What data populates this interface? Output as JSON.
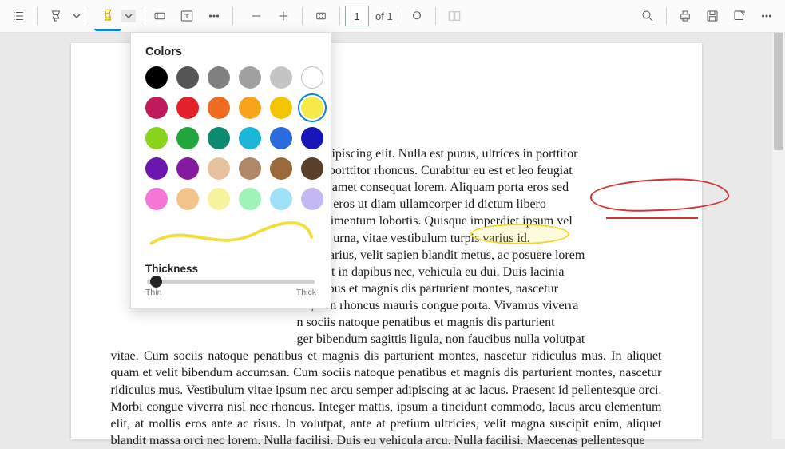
{
  "toolbar": {
    "page_current": "1",
    "page_total_label": "of 1"
  },
  "popover": {
    "title": "Colors",
    "thickness_label": "Thickness",
    "thin_label": "Thin",
    "thick_label": "Thick",
    "preview_color": "#f0df3a",
    "selected_index": 11,
    "colors": [
      "#000000",
      "#555555",
      "#808080",
      "#a0a0a0",
      "#c4c4c4",
      "#ffffff",
      "#bf1b5a",
      "#e22128",
      "#ef6b1f",
      "#f7a41d",
      "#f3c400",
      "#f7e948",
      "#8ad31b",
      "#23a53e",
      "#0c8b6e",
      "#1cb6d8",
      "#2a6be0",
      "#1916b9",
      "#6b16af",
      "#841b9e",
      "#e8c2a0",
      "#b08868",
      "#9a6a3b",
      "#5a3f29",
      "#f477d6",
      "#f0c48a",
      "#f7f29e",
      "#9ff2b8",
      "#9fe2f7",
      "#c4b8f2"
    ]
  },
  "document": {
    "lines": [
      "etur adipiscing elit. Nulla est purus, ultrices in porttitor",
      "ctetur porttitor rhoncus. Curabitur eu est et leo feugiat",
      "lor, sit amet consequat lorem. Aliquam porta eros sed",
      "empus eros ut diam ullamcorper id dictum libero",
      "a condimentum lobortis. Quisque imperdiet ipsum vel",
      "olestie urna, vitae vestibulum turpis varius id.",
      "dum varius, velit sapien blandit metus, ac posuere lorem",
      "ncidunt in dapibus nec, vehicula eu dui. Duis lacinia",
      "penatibus et magnis dis parturient montes, nascetur",
      "est, non rhoncus mauris congue porta. Vivamus viverra",
      "n sociis natoque penatibus et magnis dis parturient",
      "ger bibendum sagittis ligula, non faucibus nulla volutpat"
    ],
    "tail": "vitae. Cum sociis natoque penatibus et magnis dis parturient montes, nascetur ridiculus mus. In aliquet quam et velit bibendum accumsan. Cum sociis natoque penatibus et magnis dis parturient montes, nascetur ridiculus mus. Vestibulum vitae ipsum nec arcu semper adipiscing at ac lacus. Praesent id pellentesque orci. Morbi congue viverra nisl nec rhoncus. Integer mattis, ipsum a tincidunt commodo, lacus arcu elementum elit, at mollis eros ante ac risus. In volutpat, ante at pretium ultricies, velit magna suscipit enim, aliquet blandit massa orci nec lorem. Nulla facilisi. Duis eu vehicula arcu. Nulla facilisi. Maecenas pellentesque"
  }
}
